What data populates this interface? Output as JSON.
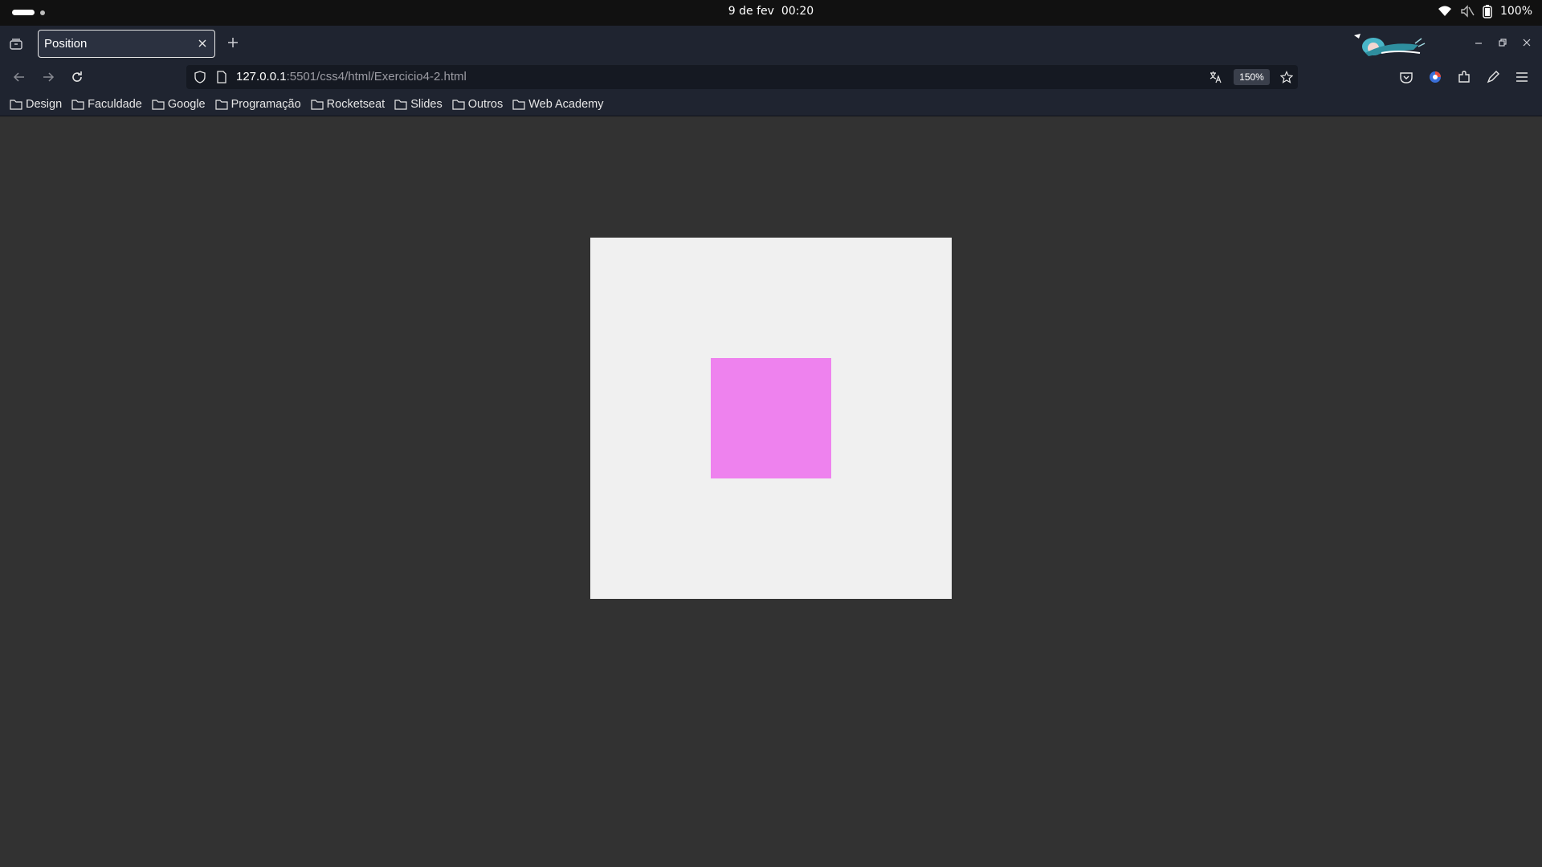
{
  "system_bar": {
    "date": "9 de fev",
    "time": "00:20",
    "battery": "100%"
  },
  "browser": {
    "tab": {
      "title": "Position"
    },
    "url": {
      "host": "127.0.0.1",
      "rest": ":5501/css4/html/Exercicio4-2.html"
    },
    "zoom": "150%",
    "bookmarks": [
      {
        "label": "Design"
      },
      {
        "label": "Faculdade"
      },
      {
        "label": "Google"
      },
      {
        "label": "Programação"
      },
      {
        "label": "Rocketseat"
      },
      {
        "label": "Slides"
      },
      {
        "label": "Outros"
      },
      {
        "label": "Web Academy"
      }
    ]
  },
  "page": {
    "background": "#323232",
    "outer_box_color": "#f0f0f0",
    "inner_box_color": "#ee82ee"
  },
  "colors": {
    "chrome": "#1f2430",
    "system_bar": "#111111"
  }
}
